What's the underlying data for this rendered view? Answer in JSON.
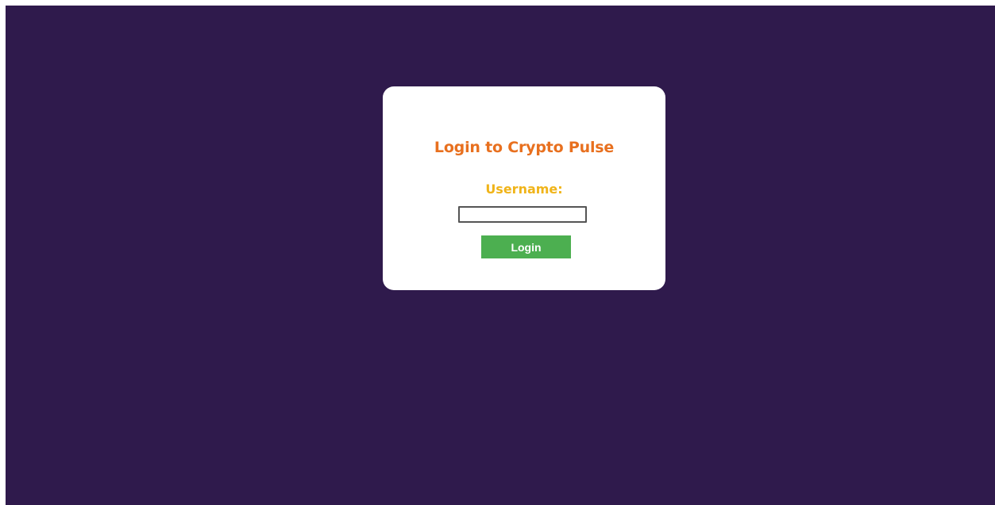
{
  "login": {
    "title": "Login to Crypto Pulse",
    "username_label": "Username:",
    "username_value": "",
    "username_placeholder": "",
    "submit_label": "Login"
  },
  "colors": {
    "background": "#2f1a4c",
    "card": "#ffffff",
    "title": "#e8701f",
    "label": "#f0b419",
    "button": "#4caf50",
    "button_text": "#ffffff"
  }
}
